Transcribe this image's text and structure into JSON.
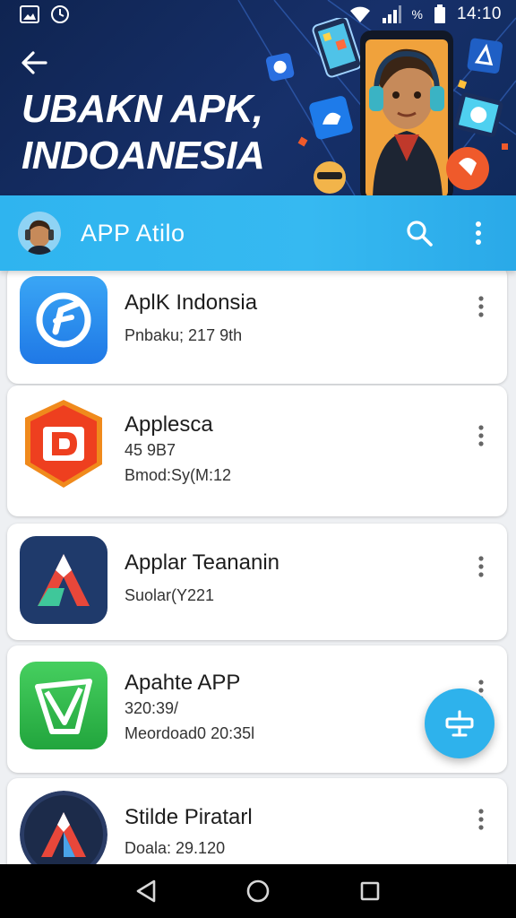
{
  "status_bar": {
    "time": "14:10",
    "battery_percent_label": "%"
  },
  "hero": {
    "title_line1": "UBAKN APK,",
    "title_line2": "INDOANESIA"
  },
  "app_bar": {
    "title": "APP Atilo"
  },
  "apps": [
    {
      "name": "AplK Indonsia",
      "meta1": "Pnbaku; 217 9th",
      "meta2": ""
    },
    {
      "name": "Applesca",
      "meta1": "45 9B7",
      "meta2": "Bmod:Sy(M:12"
    },
    {
      "name": "Applar Teananin",
      "meta1": "Suolar(Y221",
      "meta2": ""
    },
    {
      "name": "Apahte APP",
      "meta1": "320:39/",
      "meta2": "Meordoad0 20:35l"
    },
    {
      "name": "Stilde Piratarl",
      "meta1": "Doala: 29.120",
      "meta2": ""
    }
  ],
  "colors": {
    "hero_bg": "#12295c",
    "app_bar": "#34b6ef",
    "fab": "#2eb2ec",
    "icon1": "#2d8ef0",
    "icon2": "#ef4a1e",
    "icon3": "#1f3a6b",
    "icon4": "#2fb84a",
    "icon5": "#1c2b4a"
  },
  "icons": {
    "back": "arrow-left-icon",
    "search": "search-icon",
    "more": "more-vert-icon",
    "fab": "compress-icon",
    "nav": [
      "back-triangle-icon",
      "home-circle-icon",
      "recents-square-icon"
    ]
  }
}
